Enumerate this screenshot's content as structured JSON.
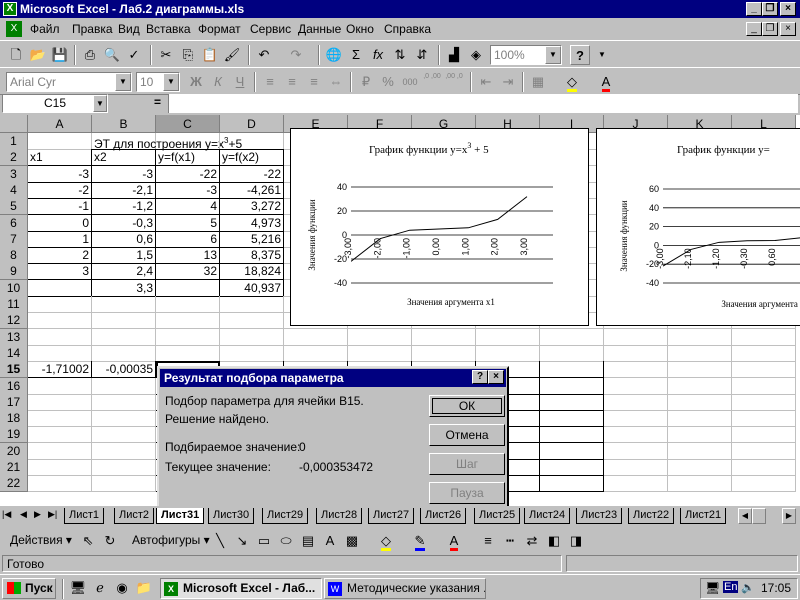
{
  "window": {
    "title": "Microsoft Excel - Лаб.2 диаграммы.xls"
  },
  "menu": [
    "Файл",
    "Правка",
    "Вид",
    "Вставка",
    "Формат",
    "Сервис",
    "Данные",
    "Окно",
    "Справка"
  ],
  "toolbar": {
    "zoom": "100%",
    "font": "Arial Cyr",
    "size": "10",
    "bold": "Ж",
    "italic": "К",
    "underline": "Ч",
    "sigma": "Σ",
    "fx": "fx",
    "percent": "%",
    "thousands": "000",
    "dec_inc": ",0 ,00",
    "dec_dec": ",00 ,0"
  },
  "formula": {
    "cell_ref": "C15",
    "eq": "="
  },
  "columns": [
    "A",
    "B",
    "C",
    "D",
    "E",
    "F",
    "G",
    "H",
    "I",
    "J",
    "K",
    "L"
  ],
  "rows": [
    "1",
    "2",
    "3",
    "4",
    "5",
    "6",
    "7",
    "8",
    "9",
    "10",
    "11",
    "12",
    "13",
    "14",
    "15",
    "16",
    "17",
    "18",
    "19",
    "20",
    "21",
    "22"
  ],
  "sheet": {
    "r1": {
      "b": "ЭТ для построения y=x",
      "sup": "3",
      "tail": "+5"
    },
    "r2": [
      "x1",
      "x2",
      "y=f(x1)",
      "y=f(x2)"
    ],
    "data": [
      [
        "-3",
        "-3",
        "-22",
        "-22"
      ],
      [
        "-2",
        "-2,1",
        "-3",
        "-4,261"
      ],
      [
        "-1",
        "-1,2",
        "4",
        "3,272"
      ],
      [
        "0",
        "-0,3",
        "5",
        "4,973"
      ],
      [
        "1",
        "0,6",
        "6",
        "5,216"
      ],
      [
        "2",
        "1,5",
        "13",
        "8,375"
      ],
      [
        "3",
        "2,4",
        "32",
        "18,824"
      ],
      [
        "",
        "3,3",
        "",
        "40,937"
      ]
    ],
    "r15": [
      "-1,71002",
      "-0,00035"
    ]
  },
  "chart1": {
    "title": "График функции y=x",
    "sup": "3",
    "title_tail": " + 5",
    "ylabel": "Значения функции",
    "xlabel": "Значения аргумента x1",
    "yticks": [
      "40",
      "20",
      "0",
      "-20",
      "-40"
    ],
    "xticks": [
      "-3,00",
      "-2,00",
      "-1,00",
      "0,00",
      "1,00",
      "2,00",
      "3,00"
    ]
  },
  "chart2": {
    "title": "График функции y=",
    "ylabel": "Значения функции",
    "xlabel": "Значения аргумента x",
    "yticks": [
      "60",
      "40",
      "20",
      "0",
      "-20",
      "-40"
    ],
    "xticks": [
      "-3,00",
      "-2,10",
      "-1,20",
      "-0,30",
      "0,60"
    ]
  },
  "chart_data": [
    {
      "type": "line",
      "title": "График функции y=x3 + 5",
      "xlabel": "Значения аргумента x1",
      "ylabel": "Значения функции",
      "x": [
        -3,
        -2,
        -1,
        0,
        1,
        2,
        3
      ],
      "series": [
        {
          "values": [
            -22,
            -3,
            4,
            5,
            6,
            13,
            32
          ]
        }
      ],
      "ylim": [
        -40,
        40
      ],
      "grid": true
    },
    {
      "type": "line",
      "title": "График функции y=",
      "xlabel": "Значения аргумента x",
      "ylabel": "Значения функции",
      "x": [
        -3,
        -2.1,
        -1.2,
        -0.3,
        0.6,
        1.5,
        2.4,
        3.3
      ],
      "series": [
        {
          "values": [
            -22,
            -4.261,
            3.272,
            4.973,
            5.216,
            8.375,
            18.824,
            40.937
          ]
        }
      ],
      "ylim": [
        -40,
        60
      ],
      "grid": true
    }
  ],
  "dialog": {
    "title": "Результат подбора параметра",
    "help": "?",
    "close": "×",
    "line1": "Подбор параметра для ячейки B15.",
    "line2": "Решение найдено.",
    "target_label": "Подбираемое значение:",
    "target_value": "0",
    "current_label": "Текущее значение:",
    "current_value": "-0,000353472",
    "ok": "ОК",
    "cancel": "Отмена",
    "step": "Шаг",
    "pause": "Пауза"
  },
  "tabs": [
    "Лист1",
    "Лист2",
    "Лист31",
    "Лист30",
    "Лист29",
    "Лист28",
    "Лист27",
    "Лист26",
    "Лист25",
    "Лист24",
    "Лист23",
    "Лист22",
    "Лист21"
  ],
  "drawing": {
    "actions": "Действия",
    "autoshapes": "Автофигуры"
  },
  "status": {
    "text": "Готово"
  },
  "taskbar": {
    "start": "Пуск",
    "task1": "Microsoft Excel - Лаб...",
    "task2": "Методические указания ...",
    "lang": "En",
    "clock": "17:05"
  }
}
